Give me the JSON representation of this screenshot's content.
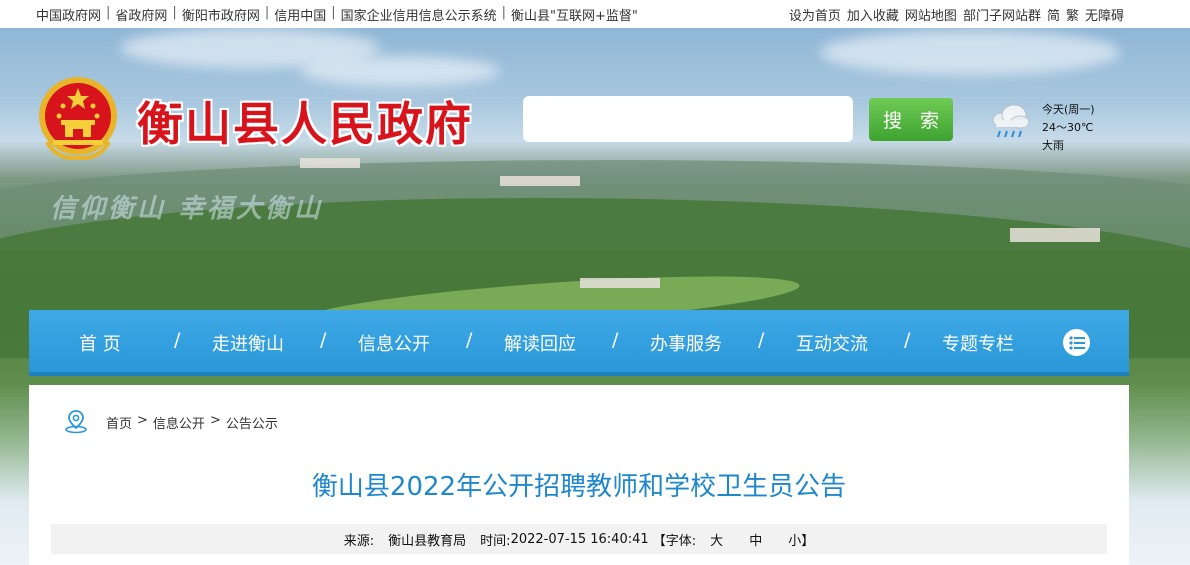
{
  "topbar": {
    "links": [
      "中国政府网",
      "省政府网",
      "衡阳市政府网",
      "信用中国",
      "国家企业信用信息公示系统",
      "衡山县\"互联网+监督\""
    ],
    "right": [
      "设为首页",
      "加入收藏",
      "网站地图",
      "部门子网站群",
      "简",
      "繁",
      "无障碍"
    ]
  },
  "header": {
    "site_title": "衡山县人民政府",
    "slogan": "信仰衡山  幸福大衡山",
    "search_placeholder": "",
    "search_button": "搜 索"
  },
  "weather": {
    "day": "今天(周一)",
    "temp": "24～30℃",
    "condition": "大雨",
    "icon": "rain-cloud-icon"
  },
  "nav": {
    "items": [
      "首  页",
      "走进衡山",
      "信息公开",
      "解读回应",
      "办事服务",
      "互动交流",
      "专题专栏"
    ],
    "separator": "/",
    "menu_icon": "list-icon"
  },
  "breadcrumb": {
    "items": [
      "首页",
      "信息公开",
      "公告公示"
    ],
    "separator": ">"
  },
  "article": {
    "title": "衡山县2022年公开招聘教师和学校卫生员公告",
    "source_label": "来源:",
    "source": "衡山县教育局",
    "time_label": "时间:",
    "time": "2022-07-15 16:40:41",
    "font_label": "【字体:",
    "font_large": "大",
    "font_medium": "中",
    "font_small": "小】"
  },
  "colors": {
    "title_red": "#d7141c",
    "nav_blue": "#2a97d8",
    "article_title_blue": "#1f87cc",
    "search_green": "#4bb33a"
  }
}
